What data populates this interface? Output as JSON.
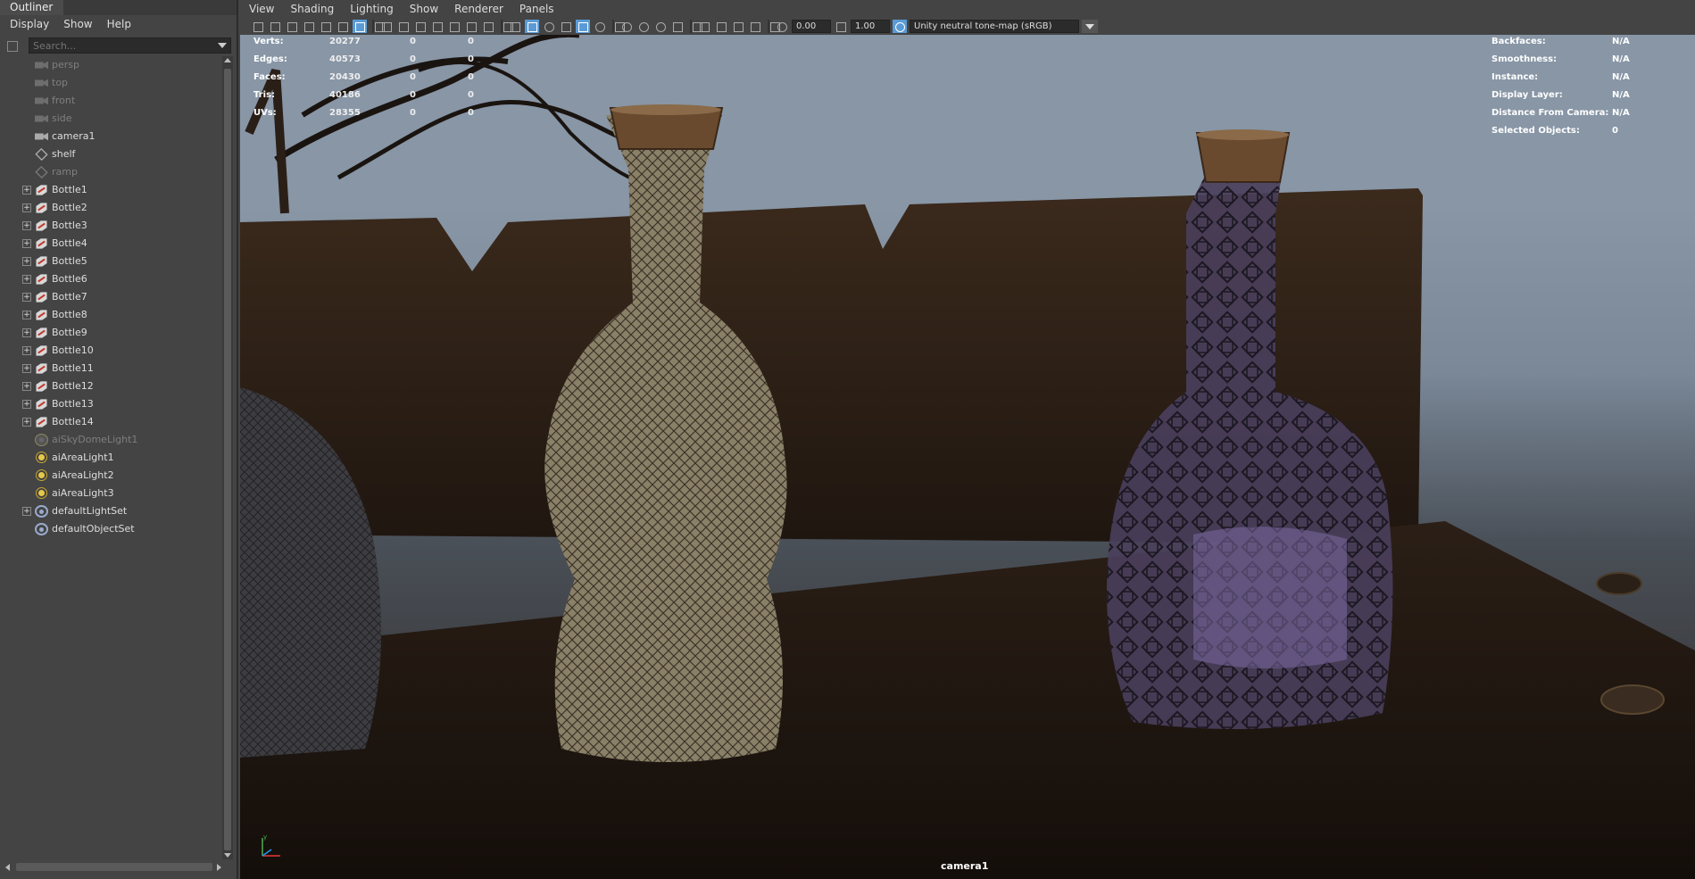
{
  "outliner": {
    "title": "Outliner",
    "menu": [
      "Display",
      "Show",
      "Help"
    ],
    "search_placeholder": "Search...",
    "items": [
      {
        "label": "persp",
        "icon": "camera-icon",
        "dim": true,
        "expandable": false
      },
      {
        "label": "top",
        "icon": "camera-icon",
        "dim": true,
        "expandable": false
      },
      {
        "label": "front",
        "icon": "camera-icon",
        "dim": true,
        "expandable": false
      },
      {
        "label": "side",
        "icon": "camera-icon",
        "dim": true,
        "expandable": false
      },
      {
        "label": "camera1",
        "icon": "camera-icon",
        "dim": false,
        "expandable": false
      },
      {
        "label": "shelf",
        "icon": "set-icon",
        "dim": false,
        "expandable": false
      },
      {
        "label": "ramp",
        "icon": "set-icon",
        "dim": true,
        "expandable": false
      },
      {
        "label": "Bottle1",
        "icon": "mesh-icon",
        "dim": false,
        "expandable": true
      },
      {
        "label": "Bottle2",
        "icon": "mesh-icon",
        "dim": false,
        "expandable": true
      },
      {
        "label": "Bottle3",
        "icon": "mesh-icon",
        "dim": false,
        "expandable": true
      },
      {
        "label": "Bottle4",
        "icon": "mesh-icon",
        "dim": false,
        "expandable": true
      },
      {
        "label": "Bottle5",
        "icon": "mesh-icon",
        "dim": false,
        "expandable": true
      },
      {
        "label": "Bottle6",
        "icon": "mesh-icon",
        "dim": false,
        "expandable": true
      },
      {
        "label": "Bottle7",
        "icon": "mesh-icon",
        "dim": false,
        "expandable": true
      },
      {
        "label": "Bottle8",
        "icon": "mesh-icon",
        "dim": false,
        "expandable": true
      },
      {
        "label": "Bottle9",
        "icon": "mesh-icon",
        "dim": false,
        "expandable": true
      },
      {
        "label": "Bottle10",
        "icon": "mesh-icon",
        "dim": false,
        "expandable": true
      },
      {
        "label": "Bottle11",
        "icon": "mesh-icon",
        "dim": false,
        "expandable": true
      },
      {
        "label": "Bottle12",
        "icon": "mesh-icon",
        "dim": false,
        "expandable": true
      },
      {
        "label": "Bottle13",
        "icon": "mesh-icon",
        "dim": false,
        "expandable": true
      },
      {
        "label": "Bottle14",
        "icon": "mesh-icon",
        "dim": false,
        "expandable": true
      },
      {
        "label": "aiSkyDomeLight1",
        "icon": "skydome-icon",
        "dim": true,
        "expandable": false
      },
      {
        "label": "aiAreaLight1",
        "icon": "light-icon",
        "dim": false,
        "expandable": false
      },
      {
        "label": "aiAreaLight2",
        "icon": "light-icon",
        "dim": false,
        "expandable": false
      },
      {
        "label": "aiAreaLight3",
        "icon": "light-icon",
        "dim": false,
        "expandable": false
      },
      {
        "label": "defaultLightSet",
        "icon": "light-set-icon",
        "dim": false,
        "expandable": true
      },
      {
        "label": "defaultObjectSet",
        "icon": "object-set-icon",
        "dim": false,
        "expandable": false
      }
    ]
  },
  "viewport": {
    "menu": [
      "View",
      "Shading",
      "Lighting",
      "Show",
      "Renderer",
      "Panels"
    ],
    "exposure": "0.00",
    "gamma": "1.00",
    "tone_map": "Unity neutral tone-map (sRGB)",
    "camera_label": "camera1",
    "hud_left": [
      {
        "key": "Verts:",
        "v1": "20277",
        "v2": "0",
        "v3": "0"
      },
      {
        "key": "Edges:",
        "v1": "40573",
        "v2": "0",
        "v3": "0"
      },
      {
        "key": "Faces:",
        "v1": "20430",
        "v2": "0",
        "v3": "0"
      },
      {
        "key": "Tris:",
        "v1": "40186",
        "v2": "0",
        "v3": "0"
      },
      {
        "key": "UVs:",
        "v1": "28355",
        "v2": "0",
        "v3": "0"
      }
    ],
    "hud_right": [
      {
        "key": "Backfaces:",
        "value": "N/A"
      },
      {
        "key": "Smoothness:",
        "value": "N/A"
      },
      {
        "key": "Instance:",
        "value": "N/A"
      },
      {
        "key": "Display Layer:",
        "value": "N/A"
      },
      {
        "key": "Distance From Camera:",
        "value": "N/A"
      },
      {
        "key": "Selected Objects:",
        "value": "0"
      }
    ],
    "axis_label": "y"
  }
}
